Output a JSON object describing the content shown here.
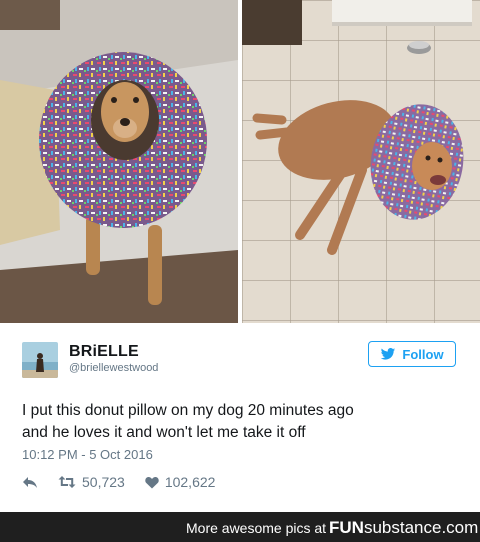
{
  "tweet": {
    "display_name": "BRiELLE",
    "handle": "@briellewestwood",
    "follow_label": "Follow",
    "text_lines": [
      "I put this donut pillow on my dog 20 minutes ago",
      "and he loves it and won't let me take it off"
    ],
    "timestamp": "10:12 PM - 5 Oct 2016",
    "retweets": "50,723",
    "likes": "102,622",
    "icons": {
      "reply": "reply-icon",
      "retweet": "retweet-icon",
      "like": "heart-icon",
      "follow": "twitter-bird-icon"
    },
    "accent_color": "#1da1f2"
  },
  "footer": {
    "prefix": "More awesome pics at",
    "brand_bold": "FUN",
    "brand_rest": "substance.com"
  }
}
